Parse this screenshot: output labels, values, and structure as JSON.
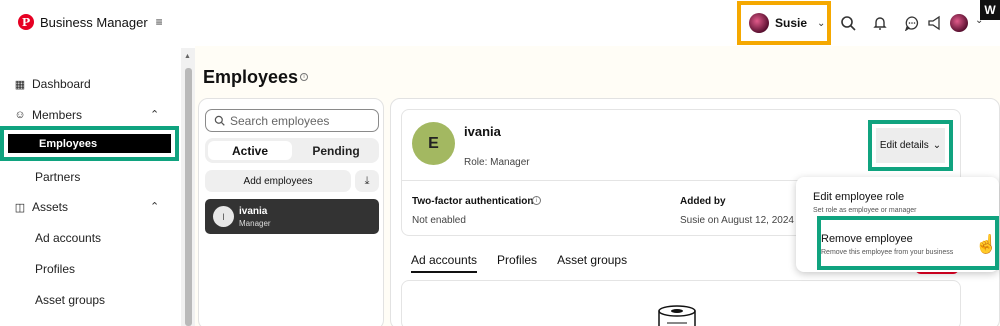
{
  "topbar": {
    "brand_logo": "P",
    "brand_title": "Business Manager",
    "menu_glyph": "≡",
    "user_name": "Susie",
    "corner_badge": "W"
  },
  "sidebar": {
    "items": [
      {
        "label": "Dashboard"
      },
      {
        "label": "Members"
      },
      {
        "label": "Employees"
      },
      {
        "label": "Partners"
      },
      {
        "label": "Assets"
      },
      {
        "label": "Ad accounts"
      },
      {
        "label": "Profiles"
      },
      {
        "label": "Asset groups"
      }
    ]
  },
  "main": {
    "title": "Employees",
    "search_placeholder": "Search employees",
    "toggle_active": "Active",
    "toggle_pending": "Pending",
    "add_employees": "Add employees",
    "employee_row": {
      "initial": "I",
      "name": "ivania",
      "role": "Manager"
    },
    "profile": {
      "initial": "E",
      "name": "ivania",
      "role": "Role: Manager",
      "edit_details": "Edit details",
      "tfa_label": "Two-factor authentication",
      "tfa_value": "Not enabled",
      "added_by_label": "Added by",
      "added_by_value": "Susie on August 12, 2024"
    },
    "tabs": [
      "Ad accounts",
      "Profiles",
      "Asset groups"
    ]
  },
  "dropdown": {
    "edit_role_title": "Edit employee role",
    "edit_role_sub": "Set role as employee or manager",
    "remove_title": "Remove employee",
    "remove_sub": "Remove this employee from your business"
  },
  "colors": {
    "highlight_green": "#10a37f",
    "highlight_orange": "#f5a800",
    "pinterest_red": "#e60023",
    "avatar_green": "#a3b861"
  },
  "icons": [
    "pinterest-logo",
    "menu-icon",
    "search-icon",
    "bell-icon",
    "chat-icon",
    "megaphone-icon",
    "chevron-down-icon",
    "dashboard-icon",
    "members-icon",
    "assets-icon",
    "download-icon",
    "info-icon",
    "hand-cursor-icon"
  ]
}
